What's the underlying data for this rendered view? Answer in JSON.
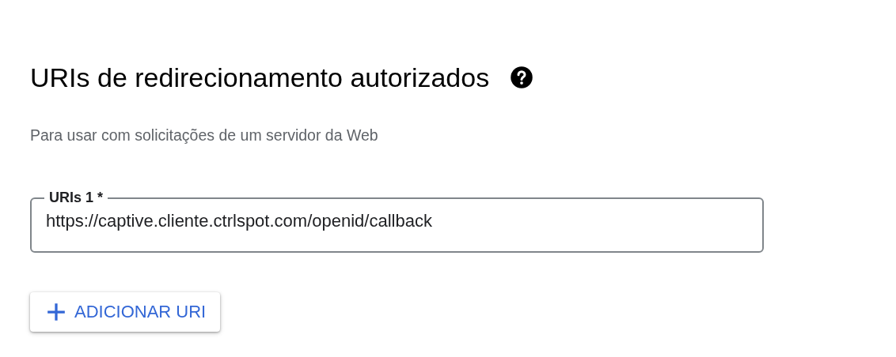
{
  "section": {
    "title": "URIs de redirecionamento autorizados",
    "description": "Para usar com solicitações de um servidor da Web"
  },
  "uri_fields": [
    {
      "label": "URIs 1 *",
      "value": "https://captive.cliente.ctrlspot.com/openid/callback"
    }
  ],
  "add_button": {
    "label": "ADICIONAR URI"
  }
}
